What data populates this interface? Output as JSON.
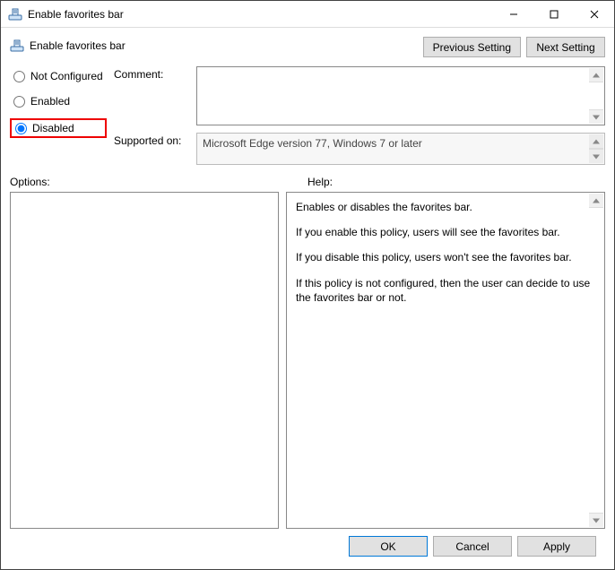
{
  "window": {
    "title": "Enable favorites bar"
  },
  "header": {
    "policy_name": "Enable favorites bar",
    "previous_label": "Previous Setting",
    "next_label": "Next Setting"
  },
  "state": {
    "not_configured_label": "Not Configured",
    "enabled_label": "Enabled",
    "disabled_label": "Disabled",
    "selected": "disabled"
  },
  "form": {
    "comment_label": "Comment:",
    "comment_value": "",
    "supported_label": "Supported on:",
    "supported_value": "Microsoft Edge version 77, Windows 7 or later"
  },
  "panes": {
    "options_label": "Options:",
    "help_label": "Help:",
    "help_paragraphs": [
      "Enables or disables the favorites bar.",
      "If you enable this policy, users will see the favorites bar.",
      "If you disable this policy, users won't see the favorites bar.",
      "If this policy is not configured, then the user can decide to use the favorites bar or not."
    ]
  },
  "footer": {
    "ok_label": "OK",
    "cancel_label": "Cancel",
    "apply_label": "Apply"
  }
}
